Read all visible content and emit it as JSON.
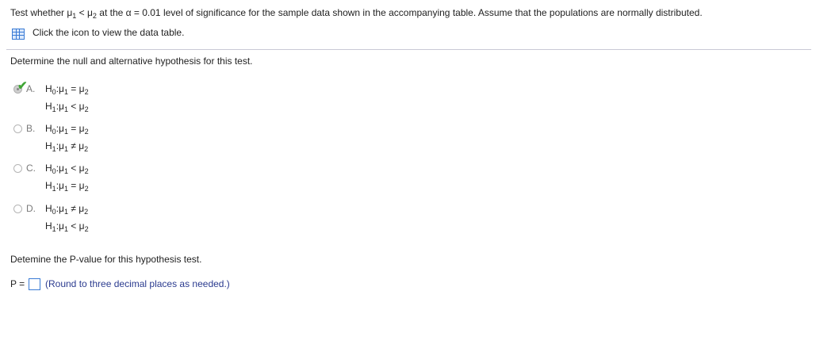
{
  "question": {
    "prefix": "Test whether ",
    "mu1_symbol": "μ",
    "mu1_sub": "1",
    "relation": " < ",
    "mu2_symbol": "μ",
    "mu2_sub": "2",
    "mid": " at the ",
    "alpha": "α",
    "alpha_value": " = 0.01",
    "suffix": " level of significance for the sample data shown in the accompanying table. Assume that the populations are normally distributed."
  },
  "data_table_link": {
    "icon": "table-icon",
    "text": "Click the icon to view the data table."
  },
  "part1": {
    "prompt": "Determine the null and alternative hypothesis for this test.",
    "selected": "A",
    "options": [
      {
        "letter": "A.",
        "h0_label": "H",
        "h0_sub": "0",
        "h0_rel": " = ",
        "h1_label": "H",
        "h1_sub": "1",
        "h1_rel": " < "
      },
      {
        "letter": "B.",
        "h0_label": "H",
        "h0_sub": "0",
        "h0_rel": " = ",
        "h1_label": "H",
        "h1_sub": "1",
        "h1_rel": " ≠ "
      },
      {
        "letter": "C.",
        "h0_label": "H",
        "h0_sub": "0",
        "h0_rel": " < ",
        "h1_label": "H",
        "h1_sub": "1",
        "h1_rel": " = "
      },
      {
        "letter": "D.",
        "h0_label": "H",
        "h0_sub": "0",
        "h0_rel": " ≠ ",
        "h1_label": "H",
        "h1_sub": "1",
        "h1_rel": " < "
      }
    ]
  },
  "part2": {
    "prompt": "Detemine the P-value for this hypothesis test.",
    "p_label": "P =",
    "p_value": "",
    "hint": "(Round to three decimal places as needed.)"
  },
  "colors": {
    "accent": "#3a7bd5",
    "correct_check": "#3fa535",
    "hint_text": "#2b3b8f"
  }
}
